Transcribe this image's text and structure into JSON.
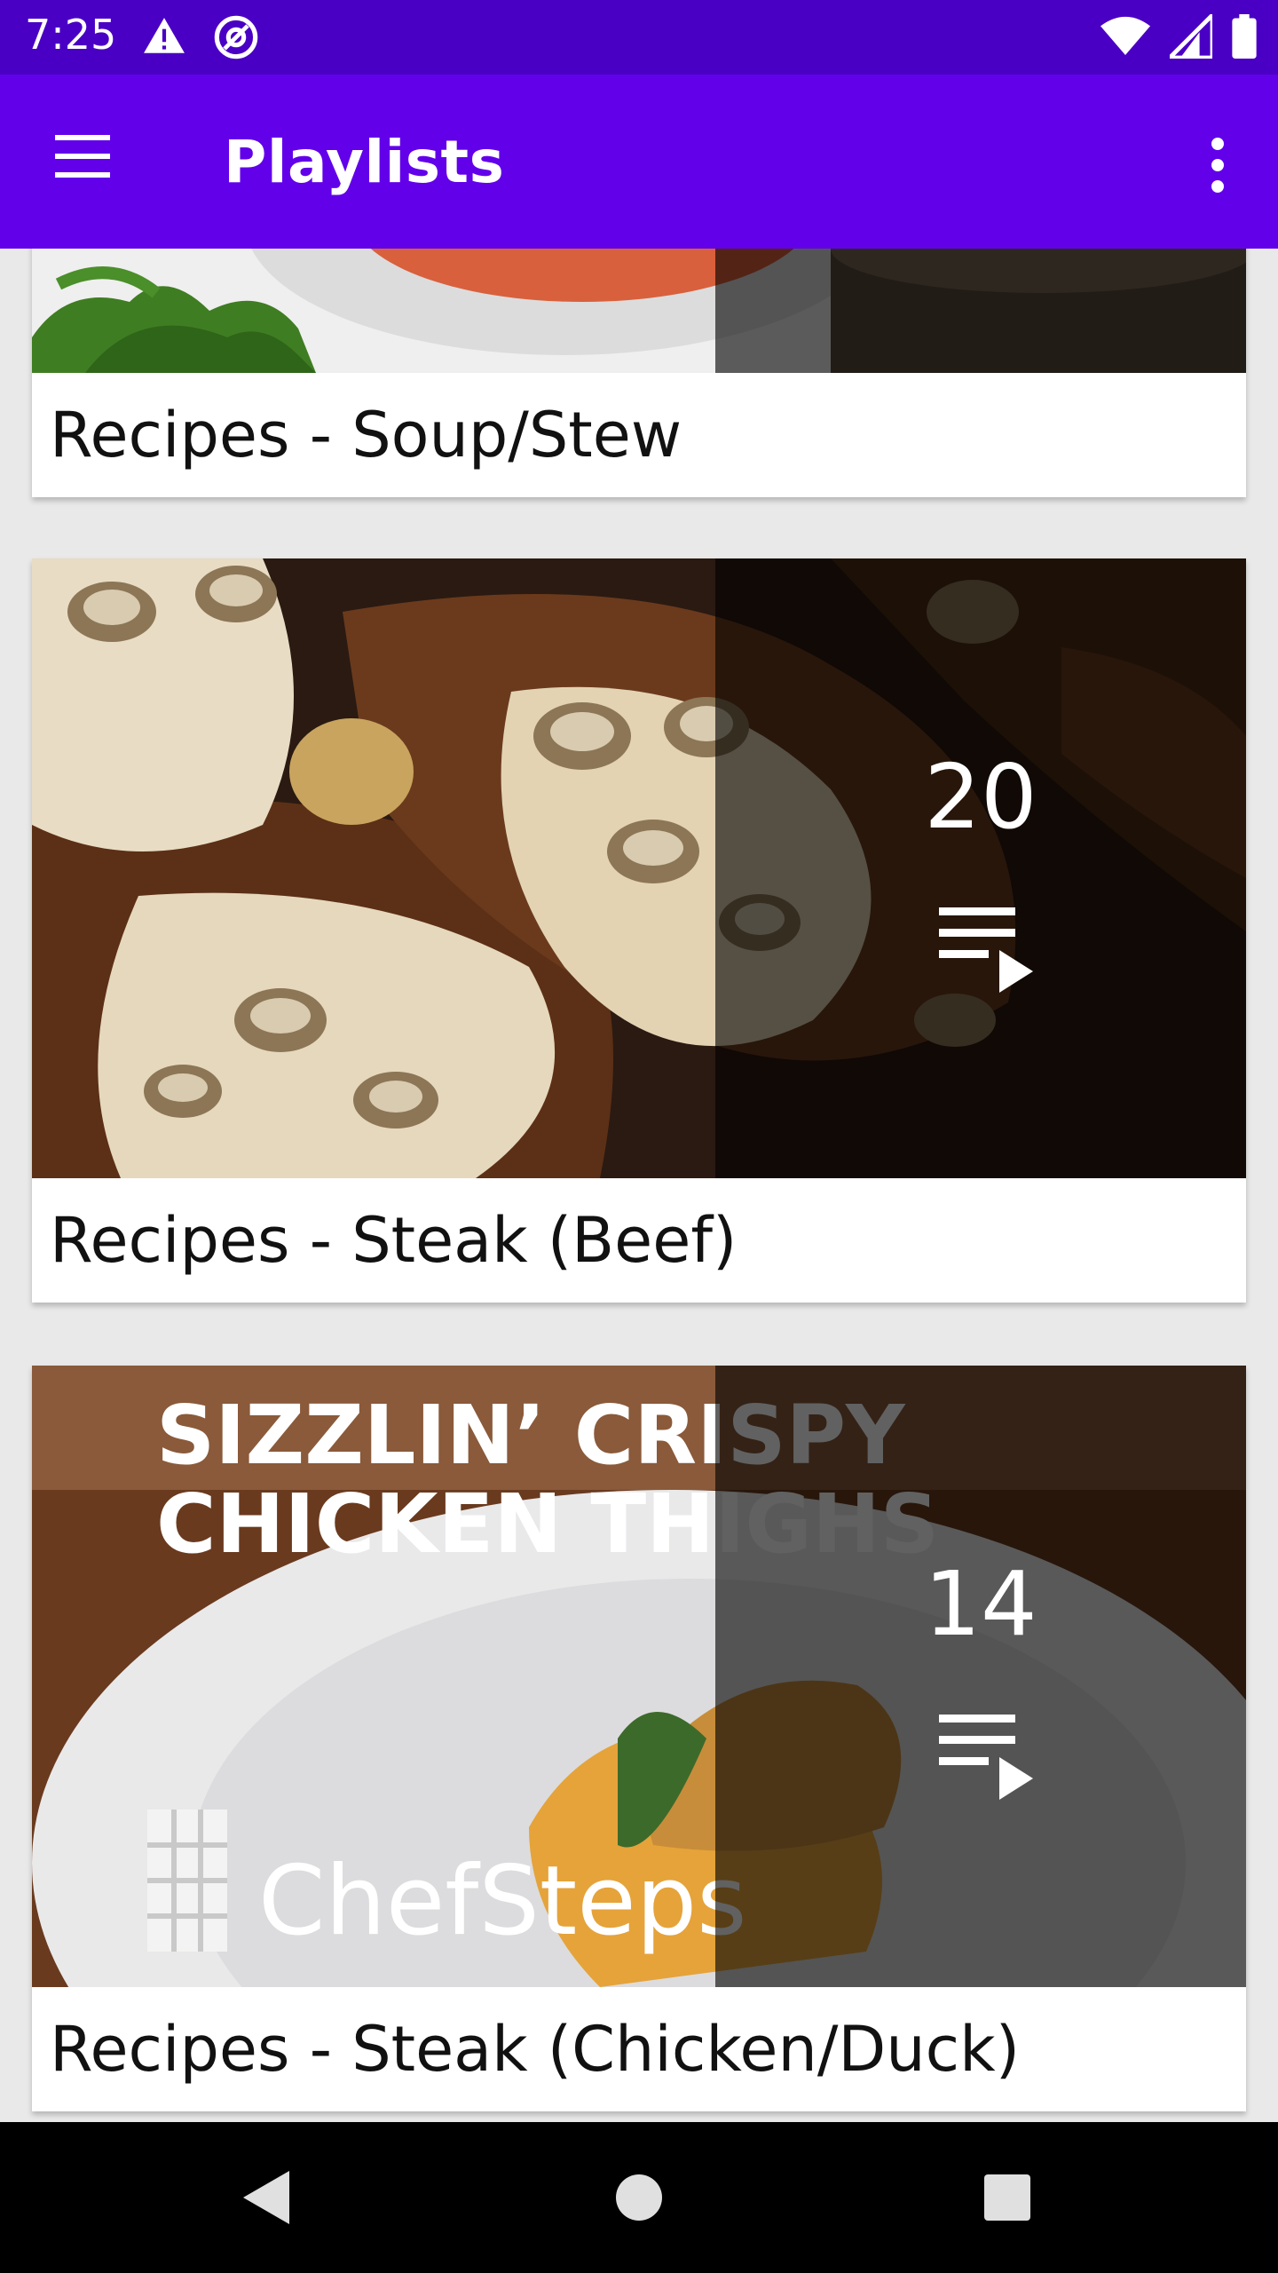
{
  "status_bar": {
    "time": "7:25",
    "left_icons": [
      "warning-icon",
      "at-sign-icon"
    ],
    "right_icons": [
      "wifi-icon",
      "cell-signal-icon",
      "battery-icon"
    ],
    "background": "#4a00c4"
  },
  "app_bar": {
    "title": "Playlists",
    "background": "#6200ea",
    "menu_icon": "hamburger-menu-icon",
    "overflow_icon": "more-vert-icon"
  },
  "playlists": [
    {
      "title": "Recipes - Soup/Stew",
      "count": ""
    },
    {
      "title": "Recipes - Steak (Beef)",
      "count": "20"
    },
    {
      "title": "Recipes - Steak (Chicken/Duck)",
      "count": "14"
    }
  ],
  "thumbnail_text": {
    "line1": "SIZZLIN’ CRISPY",
    "line2": "CHICKEN THIGHS",
    "brand": "ChefSteps"
  },
  "nav_bar": {
    "icons": [
      "back-icon",
      "home-icon",
      "recents-icon"
    ]
  }
}
